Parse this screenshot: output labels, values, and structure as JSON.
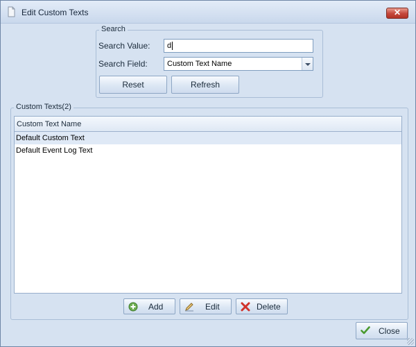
{
  "window": {
    "title": "Edit Custom Texts"
  },
  "search": {
    "group_title": "Search",
    "value_label": "Search Value:",
    "value": "d",
    "field_label": "Search Field:",
    "field_selected": "Custom Text Name",
    "reset_label": "Reset",
    "refresh_label": "Refresh"
  },
  "list": {
    "group_title": "Custom Texts(2)",
    "column_header": "Custom Text Name",
    "rows": [
      "Default Custom Text",
      "Default Event Log Text"
    ],
    "selected_index": 0
  },
  "actions": {
    "add_label": "Add",
    "edit_label": "Edit",
    "delete_label": "Delete"
  },
  "footer": {
    "close_label": "Close"
  },
  "icons": {
    "app": "sheet-icon",
    "add": "plus-circle-icon",
    "edit": "pencil-icon",
    "delete": "red-x-icon",
    "close": "green-check-icon"
  },
  "colors": {
    "accent": "#c4463a",
    "window_bg": "#d6e2f1",
    "selection": "#dfe9f6"
  }
}
